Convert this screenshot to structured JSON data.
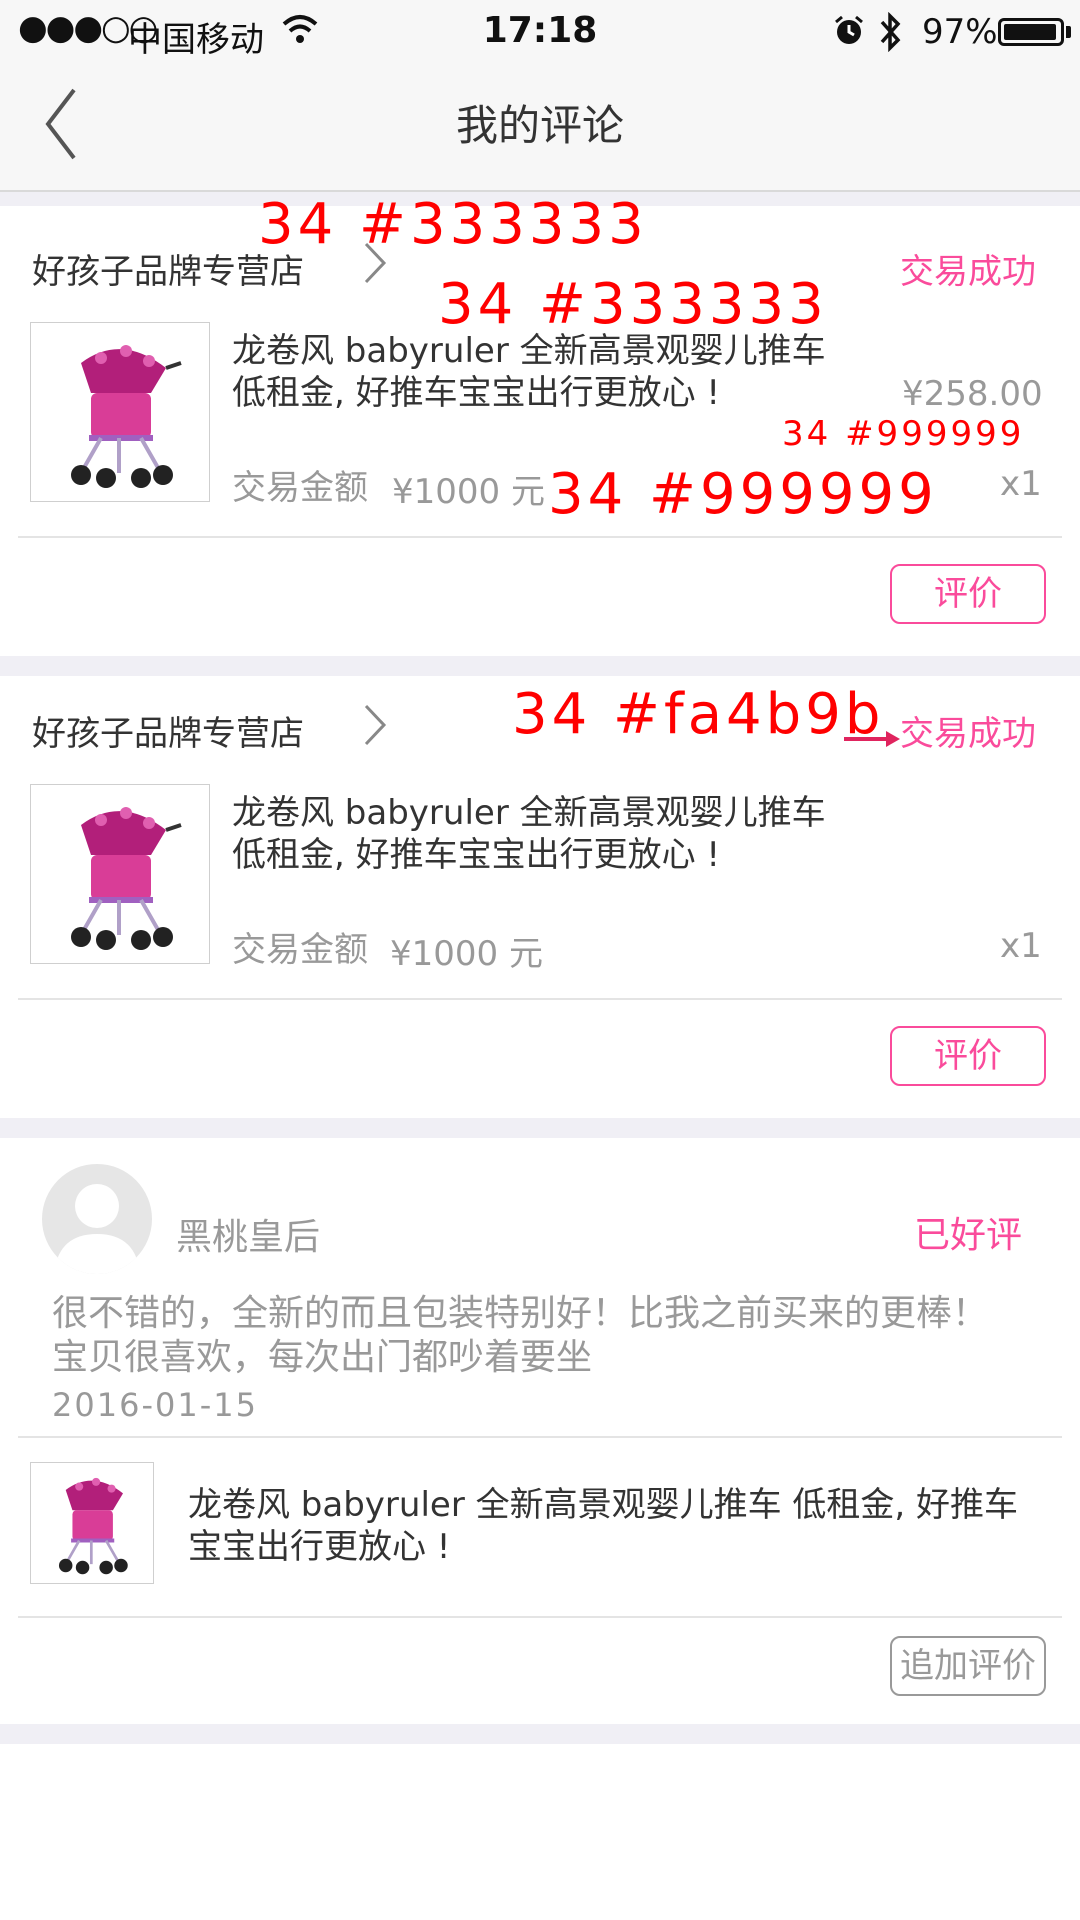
{
  "status_bar": {
    "signal": "●●●○○",
    "carrier": "中国移动",
    "time": "17:18",
    "battery": "97%",
    "battery_level": 0.97
  },
  "nav": {
    "title": "我的评论"
  },
  "orders": [
    {
      "shop": "好孩子品牌专营店",
      "status": "交易成功",
      "title_line1": "龙卷风 babyruler  全新高景观婴儿推车",
      "title_line2": "低租金, 好推车宝宝出行更放心 !",
      "price": "¥258.00",
      "amount_label": "交易金额",
      "amount": "¥1000 元",
      "qty": "x1",
      "button": "评价"
    },
    {
      "shop": "好孩子品牌专营店",
      "status": "交易成功",
      "title_line1": "龙卷风 babyruler  全新高景观婴儿推车",
      "title_line2": "低租金, 好推车宝宝出行更放心 !",
      "amount_label": "交易金额",
      "amount": "¥1000 元",
      "qty": "x1",
      "button": "评价"
    }
  ],
  "review": {
    "user": "黑桃皇后",
    "badge": "已好评",
    "text_line1": "很不错的，全新的而且包装特别好！比我之前买来的更棒！",
    "text_line2": "宝贝很喜欢，每次出门都吵着要坐",
    "date": "2016-01-15",
    "product_line1": "龙卷风 babyruler  全新高景观婴儿推车 低租金, 好推车",
    "product_line2": "宝宝出行更放心 !",
    "button": "追加评价"
  },
  "annotations": {
    "a1": "34  #333333",
    "a2": "34  #333333",
    "a3": "34  #999999",
    "a4": "34  #999999",
    "a5": "34  #fa4b9b"
  },
  "colors": {
    "accent": "#fa4b9b",
    "text_primary": "#333333",
    "text_secondary": "#999999",
    "annotation": "#ff0000"
  }
}
